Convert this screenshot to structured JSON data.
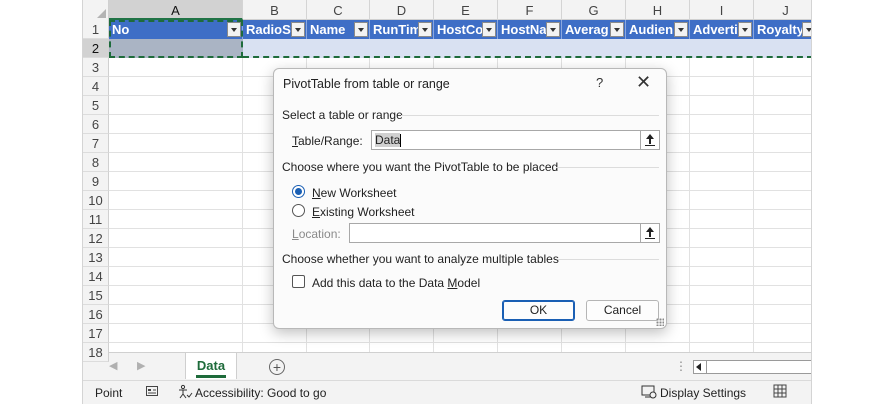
{
  "columns": [
    "A",
    "B",
    "C",
    "D",
    "E",
    "F",
    "G",
    "H",
    "I",
    "J"
  ],
  "rows": [
    "1",
    "2",
    "3",
    "4",
    "5",
    "6",
    "7",
    "8",
    "9",
    "10",
    "11",
    "12",
    "13",
    "14",
    "15",
    "16",
    "17",
    "18"
  ],
  "table_headers": [
    "No",
    "RadioSt",
    "Name",
    "RunTim",
    "HostCo",
    "HostNa",
    "Averag",
    "Audien",
    "Adverti",
    "Royalty"
  ],
  "sheet": {
    "tab_name": "Data",
    "add_sheet": "+",
    "nav_prev": "◀",
    "nav_next": "▶",
    "more": "⋮"
  },
  "status": {
    "mode": "Point",
    "accessibility": "Accessibility: Good to go",
    "display_settings": "Display Settings"
  },
  "dialog": {
    "title": "PivotTable from table or range",
    "help": "?",
    "close": "✕",
    "section1": "Select a table or range",
    "range_label_u": "T",
    "range_label_rest": "able/Range:",
    "range_value": "Data",
    "section2": "Choose where you want the PivotTable to be placed",
    "opt_new_u": "N",
    "opt_new_rest": "ew Worksheet",
    "opt_existing_u": "E",
    "opt_existing_rest": "xisting Worksheet",
    "location_label_u": "L",
    "location_label_rest": "ocation:",
    "location_value": "",
    "section3": "Choose whether you want to analyze multiple tables",
    "datamodel_pre": "Add this data to the Data ",
    "datamodel_u": "M",
    "datamodel_rest": "odel",
    "ok": "OK",
    "cancel": "Cancel",
    "selected_option": "new",
    "datamodel_checked": false
  },
  "colors": {
    "header_fill": "#3e6ec6",
    "selection": "#1e6b3b",
    "accent": "#1a5fb4"
  }
}
